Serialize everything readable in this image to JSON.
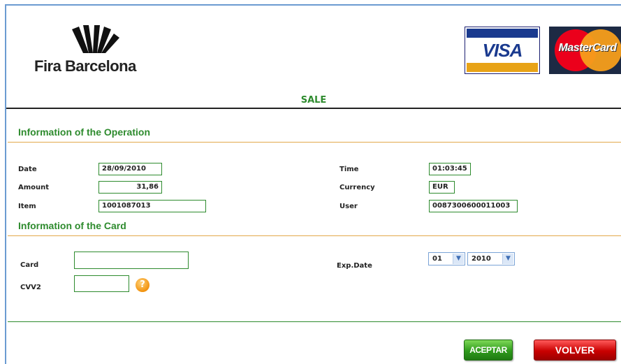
{
  "header": {
    "brand": "Fira Barcelona",
    "card_logos": {
      "visa": "VISA",
      "mastercard": "MasterCard"
    },
    "title": "SALE"
  },
  "operation": {
    "heading": "Information of the Operation",
    "date_label": "Date",
    "date_value": "28/09/2010",
    "time_label": "Time",
    "time_value": "01:03:45",
    "amount_label": "Amount",
    "amount_value": "31,86",
    "currency_label": "Currency",
    "currency_value": "EUR",
    "item_label": "Item",
    "item_value": "1001087013",
    "user_label": "User",
    "user_value": "0087300600011003"
  },
  "card": {
    "heading": "Information of the Card",
    "card_label": "Card",
    "card_value": "",
    "cvv_label": "CVV2",
    "cvv_value": "",
    "help_icon": "question-icon",
    "exp_label": "Exp.Date",
    "exp_month": "01",
    "exp_year": "2010"
  },
  "buttons": {
    "accept": "ACEPTAR",
    "back": "VOLVER"
  },
  "colors": {
    "accent_green": "#2e8b2e",
    "section_rule": "#e3a84a",
    "accept": "#2f9a1c",
    "back": "#c90000"
  }
}
